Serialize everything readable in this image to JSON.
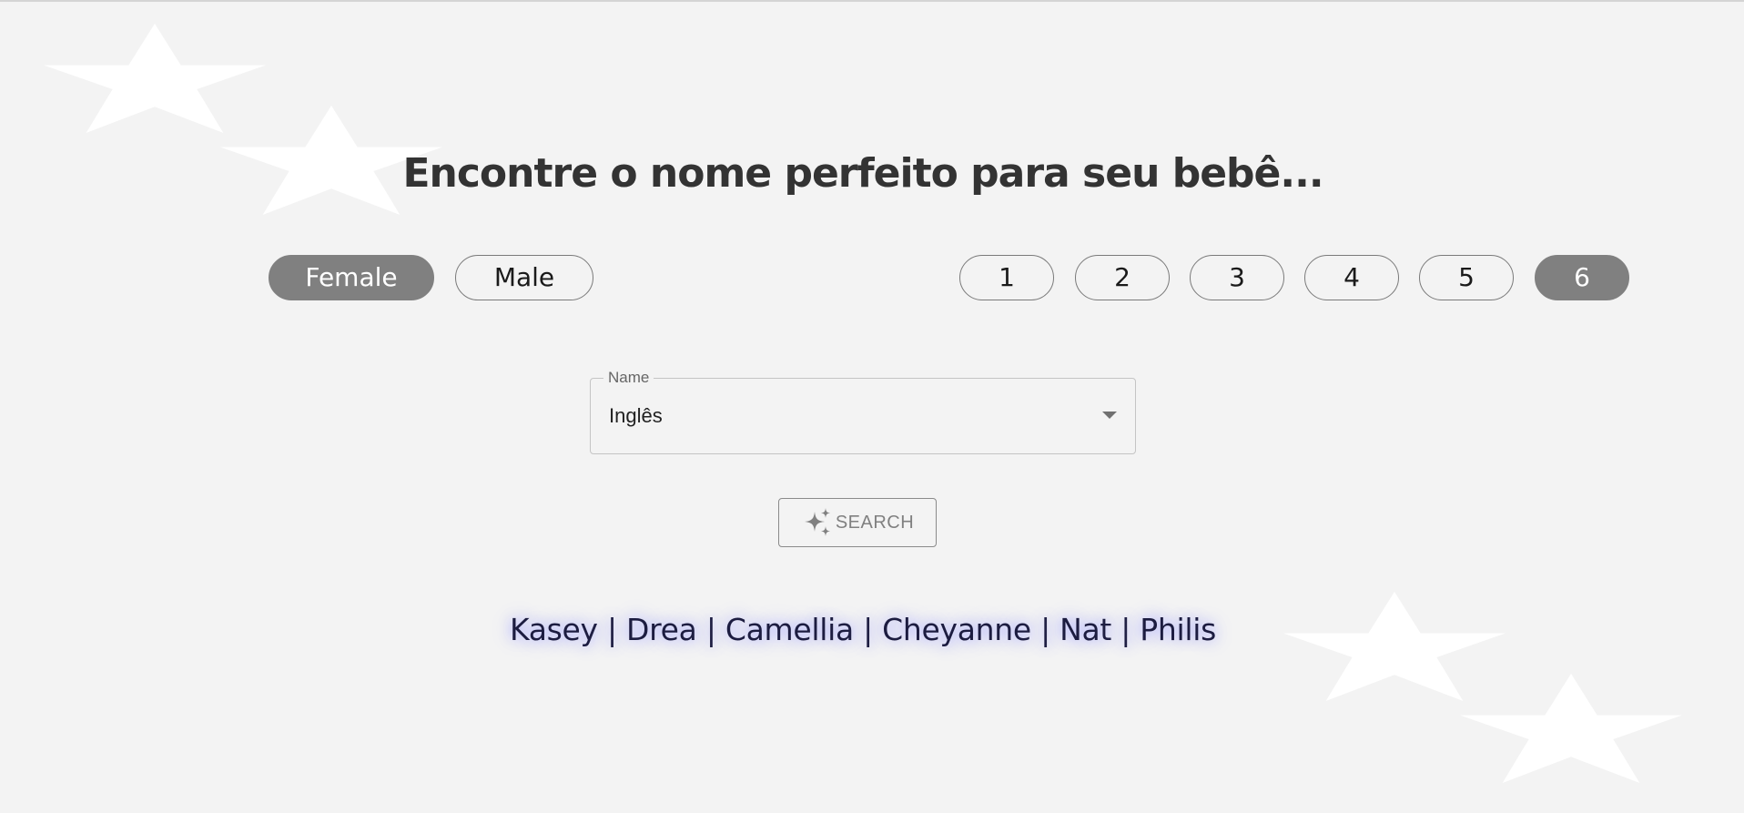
{
  "header": {
    "title": "Encontre o nome perfeito para seu bebê..."
  },
  "gender": {
    "options": [
      "Female",
      "Male"
    ],
    "selected": "Female"
  },
  "length": {
    "options": [
      "1",
      "2",
      "3",
      "4",
      "5",
      "6"
    ],
    "selected": "6"
  },
  "origin_select": {
    "label": "Name",
    "value": "Inglês"
  },
  "search": {
    "label": "SEARCH"
  },
  "results": {
    "names": [
      "Kasey",
      "Drea",
      "Camellia",
      "Cheyanne",
      "Nat",
      "Philis"
    ],
    "separator": "|"
  },
  "colors": {
    "background": "#f3f3f3",
    "active_pill": "#808080",
    "star": "#ffffff",
    "result_glow": "#a4a6ff"
  },
  "icons": {
    "decoration": "star-icon",
    "dropdown": "caret-down-icon",
    "search": "sparkle-icon"
  }
}
